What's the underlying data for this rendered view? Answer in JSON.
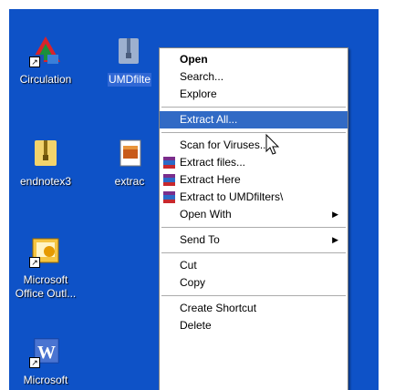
{
  "desktop": {
    "background": "#0e52c7",
    "icons": [
      {
        "name": "circulation",
        "label": "Circulation",
        "icon": "circulation-app-icon",
        "selected": false
      },
      {
        "name": "umdfilters",
        "label": "UMDfilte",
        "icon": "zip-folder-icon",
        "selected": true
      },
      {
        "name": "endnotex3",
        "label": "endnotex3",
        "icon": "zip-folder-icon",
        "selected": false
      },
      {
        "name": "extrac",
        "label": "extrac",
        "icon": "archive-file-icon",
        "selected": false
      },
      {
        "name": "microsoft-office-outlook",
        "label1": "Microsoft",
        "label2": "Office Outl...",
        "icon": "outlook-icon",
        "selected": false
      },
      {
        "name": "microsoft-word",
        "label": "Microsoft",
        "icon": "word-icon",
        "selected": false
      }
    ]
  },
  "context_menu": {
    "items": [
      {
        "label": "Open",
        "bold": true
      },
      {
        "label": "Search..."
      },
      {
        "label": "Explore"
      },
      {
        "separator": true
      },
      {
        "label": "Extract All...",
        "highlighted": true
      },
      {
        "separator": true
      },
      {
        "label": "Scan for Viruses..."
      },
      {
        "label": "Extract files...",
        "icon": "winrar-icon"
      },
      {
        "label": "Extract Here",
        "icon": "winrar-icon"
      },
      {
        "label": "Extract to UMDfilters\\",
        "icon": "winrar-icon"
      },
      {
        "label": "Open With",
        "submenu": true
      },
      {
        "separator": true
      },
      {
        "label": "Send To",
        "submenu": true
      },
      {
        "separator": true
      },
      {
        "label": "Cut"
      },
      {
        "label": "Copy"
      },
      {
        "separator": true
      },
      {
        "label": "Create Shortcut"
      },
      {
        "label": "Delete"
      }
    ],
    "highlight_color": "#316ac5",
    "submenu_arrow": "▶"
  },
  "cursor": "mouse-pointer-icon"
}
